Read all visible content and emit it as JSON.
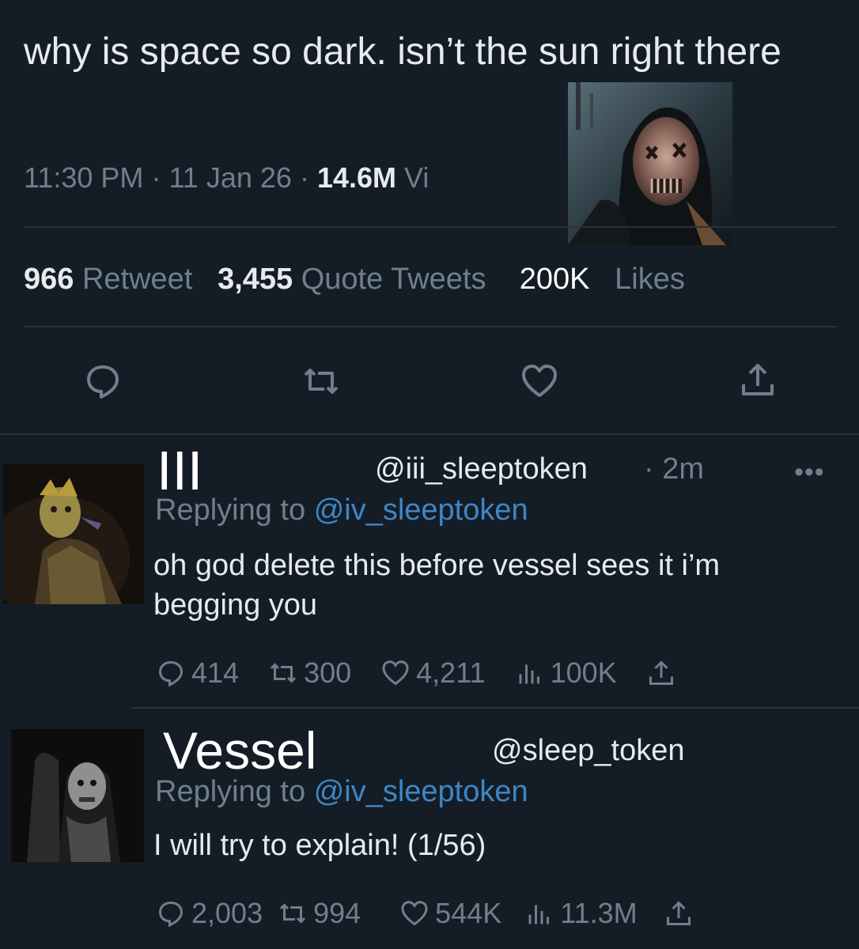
{
  "tweet": {
    "text": "why is space so dark. isn’t the sun right there",
    "time": "11:30 PM",
    "date": "11 Jan 26",
    "views_count": "14.6M",
    "views_label": "Vi",
    "retweets_count": "966",
    "retweets_label": "Retweet",
    "quotes_count": "3,455",
    "quotes_label": "Quote Tweets",
    "likes_count": "200K",
    "likes_label": "Likes",
    "sep": "·"
  },
  "replies": [
    {
      "name": "III",
      "handle": "@iii_sleeptoken",
      "age": "· 2m",
      "replying_prefix": "Replying to",
      "replying_handle": "@iv_sleeptoken",
      "text": "oh god delete this before vessel sees it i’m begging you",
      "replies": "414",
      "retweets": "300",
      "likes": "4,211",
      "views": "100K",
      "more": "•••"
    },
    {
      "name": "Vessel",
      "handle": "@sleep_token",
      "replying_prefix": "Replying to",
      "replying_handle": "@iv_sleeptoken",
      "text": "I will try to explain! (1/56)",
      "replies": "2,003",
      "retweets": "994",
      "likes": "544K",
      "views": "11.3M"
    }
  ],
  "colors": {
    "background": "#141d26",
    "text": "#e7ebee",
    "muted": "#6f7f8c",
    "link": "#3f86c5"
  },
  "icons": [
    "reply-icon",
    "retweet-icon",
    "like-icon",
    "share-icon",
    "views-icon",
    "more-icon"
  ]
}
